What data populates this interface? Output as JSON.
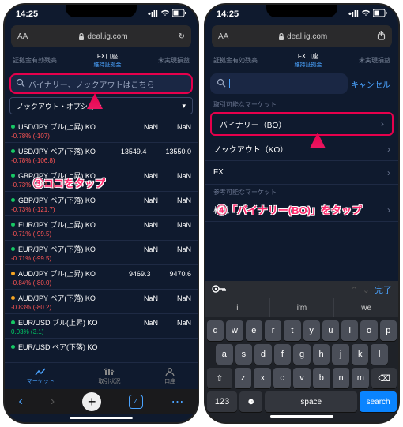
{
  "status": {
    "time": "14:25"
  },
  "address": {
    "url": "deal.ig.com"
  },
  "header": {
    "left": "証拠金有効残高",
    "mid_top": "FX口座",
    "mid_sub": "維持証拠金",
    "right": "未実現損益"
  },
  "left": {
    "search_placeholder": "バイナリー、ノックアウトはこちら",
    "dropdown": "ノックアウト・オプション",
    "rows": [
      {
        "name": "USD/JPY ブル(上昇) KO",
        "pct": "-0.78% (-107)",
        "v1": "NaN",
        "v2": "NaN",
        "dot": "green"
      },
      {
        "name": "USD/JPY ベア(下落) KO",
        "pct": "-0.78% (-106.8)",
        "v1": "13549.4",
        "v2": "13550.0",
        "dot": "green"
      },
      {
        "name": "GBP/JPY ブル(上昇) KO",
        "pct": "-0.73% (-121.7)",
        "v1": "NaN",
        "v2": "NaN",
        "dot": "green"
      },
      {
        "name": "GBP/JPY ベア(下落) KO",
        "pct": "-0.73% (-121.7)",
        "v1": "NaN",
        "v2": "NaN",
        "dot": "green"
      },
      {
        "name": "EUR/JPY ブル(上昇) KO",
        "pct": "-0.71% (-99.5)",
        "v1": "NaN",
        "v2": "NaN",
        "dot": "green"
      },
      {
        "name": "EUR/JPY ベア(下落) KO",
        "pct": "-0.71% (-99.5)",
        "v1": "NaN",
        "v2": "NaN",
        "dot": "green"
      },
      {
        "name": "AUD/JPY ブル(上昇) KO",
        "pct": "-0.84% (-80.0)",
        "v1": "9469.3",
        "v2": "9470.6",
        "dot": "amber"
      },
      {
        "name": "AUD/JPY ベア(下落) KO",
        "pct": "-0.83% (-80.2)",
        "v1": "NaN",
        "v2": "NaN",
        "dot": "amber"
      },
      {
        "name": "EUR/USD ブル(上昇) KO",
        "pct": "0.03% (3.1)",
        "v1": "NaN",
        "v2": "NaN",
        "dot": "green",
        "pos": true
      },
      {
        "name": "EUR/USD ベア(下落) KO",
        "pct": "",
        "v1": "",
        "v2": "",
        "dot": "green"
      }
    ],
    "bottomnav": {
      "market": "マーケット",
      "status": "取引状況",
      "account": "口座"
    },
    "safari_tabs": "4"
  },
  "right": {
    "cancel": "キャンセル",
    "sec1": "取引可能なマーケット",
    "opt1": "バイナリー（BO）",
    "opt2": "ノックアウト（KO）",
    "opt3": "FX",
    "sec2": "参考可能なマーケット",
    "opt4": "株式",
    "kb_done": "完了",
    "sugg": [
      "i",
      "i'm",
      "we"
    ],
    "keys1": [
      "q",
      "w",
      "e",
      "r",
      "t",
      "y",
      "u",
      "i",
      "o",
      "p"
    ],
    "keys2": [
      "a",
      "s",
      "d",
      "f",
      "g",
      "h",
      "j",
      "k",
      "l"
    ],
    "keys3": [
      "z",
      "x",
      "c",
      "v",
      "b",
      "n",
      "m"
    ],
    "key_123": "123",
    "key_space": "space",
    "key_search": "search"
  },
  "annotations": {
    "left": "③ココをタップ",
    "right": "④「バイナリー(BO)」をタップ"
  }
}
